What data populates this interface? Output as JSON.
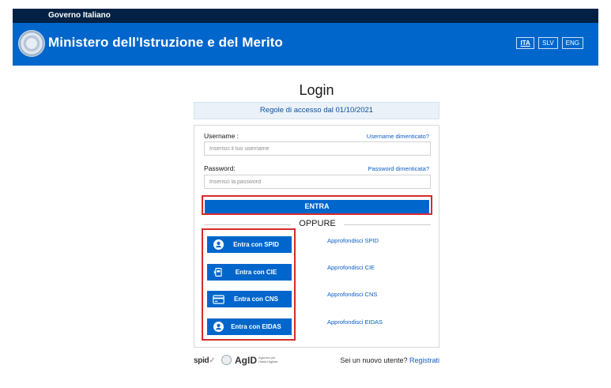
{
  "topbar": {
    "text": "Governo Italiano"
  },
  "header": {
    "title": "Ministero dell'Istruzione e del Merito",
    "languages": [
      {
        "code": "ITA",
        "active": true
      },
      {
        "code": "SLV",
        "active": false
      },
      {
        "code": "ENG",
        "active": false
      }
    ]
  },
  "login": {
    "title": "Login",
    "rules_link": "Regole di accesso dal 01/10/2021",
    "username": {
      "label": "Username :",
      "placeholder": "Inserisci il tuo username",
      "forgot": "Username dimenticato?"
    },
    "password": {
      "label": "Password:",
      "placeholder": "Inserisci la password",
      "forgot": "Password dimenticata?"
    },
    "submit": "ENTRA",
    "separator": "OPPURE",
    "alt_methods": [
      {
        "label": "Entra con SPID",
        "more": "Approfondisci SPID",
        "icon": "user-circle-icon"
      },
      {
        "label": "Entra con CIE",
        "more": "Approfondisci CIE",
        "icon": "id-card-nfc-icon"
      },
      {
        "label": "Entra con CNS",
        "more": "Approfondisci CNS",
        "icon": "smart-card-icon"
      },
      {
        "label": "Entra con EIDAS",
        "more": "Approfondisci EIDAS",
        "icon": "user-circle-icon"
      }
    ]
  },
  "footer": {
    "spid_logo": "spid",
    "agid_logo": "AgID",
    "agid_sub": "Agenzia per l'Italia Digitale",
    "register_prompt": "Sei un nuovo utente?",
    "register_link": "Registrati"
  },
  "colors": {
    "header_blue": "#0066cc",
    "topbar_navy": "#002143",
    "highlight_red": "#d52b2b",
    "link_blue": "#0b5ec8"
  }
}
